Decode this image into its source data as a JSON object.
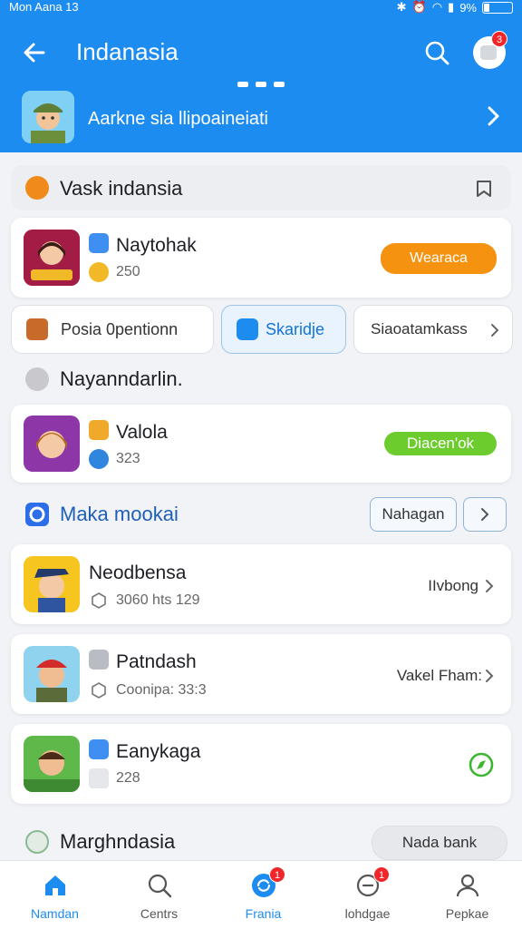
{
  "status_bar": {
    "time": "Mon Aana 13",
    "battery": "9%",
    "battery_level": 0.18
  },
  "topbar": {
    "title": "Indanasia",
    "notification_count": "3"
  },
  "banner": {
    "text": "Aarkne sia llipoaineiati"
  },
  "section_vask": {
    "title": "Vask indansia"
  },
  "app_naytohak": {
    "name": "Naytohak",
    "meta": "250",
    "button": "Wearaca",
    "button_color": "#f5920f"
  },
  "chips": [
    {
      "label": "Posia 0pentionn"
    },
    {
      "label": "Skaridje"
    },
    {
      "label": "Siaoatamkass"
    }
  ],
  "section_nayan": {
    "title": "Nayanndarlin."
  },
  "app_valola": {
    "name": "Valola",
    "meta": "323",
    "button": "Diacen'ok",
    "button_color": "#6dcc2d"
  },
  "section_maka": {
    "title": "Maka mookai",
    "action": "Nahagan"
  },
  "app_nepdbensa": {
    "name": "Neodbensa",
    "meta": "3060 hts 129",
    "link": "IIvbong"
  },
  "app_patndash": {
    "name": "Patndash",
    "meta": "Coonipa: 33:3",
    "link": "Vakel Fham:"
  },
  "app_eanykaga": {
    "name": "Eanykaga",
    "meta": "228"
  },
  "section_margh": {
    "title": "Marghndasia",
    "action": "Nada bank"
  },
  "tabs": [
    {
      "label": "Namdan",
      "active": true
    },
    {
      "label": "Centrs",
      "active": false
    },
    {
      "label": "Frania",
      "active": false,
      "badge": "1"
    },
    {
      "label": "lohdgae",
      "active": false,
      "badge": "1"
    },
    {
      "label": "Pepkae",
      "active": false
    }
  ],
  "colors": {
    "primary": "#1d8cf0",
    "orange": "#f5920f",
    "green": "#6dcc2d",
    "badge": "#f0262b"
  }
}
